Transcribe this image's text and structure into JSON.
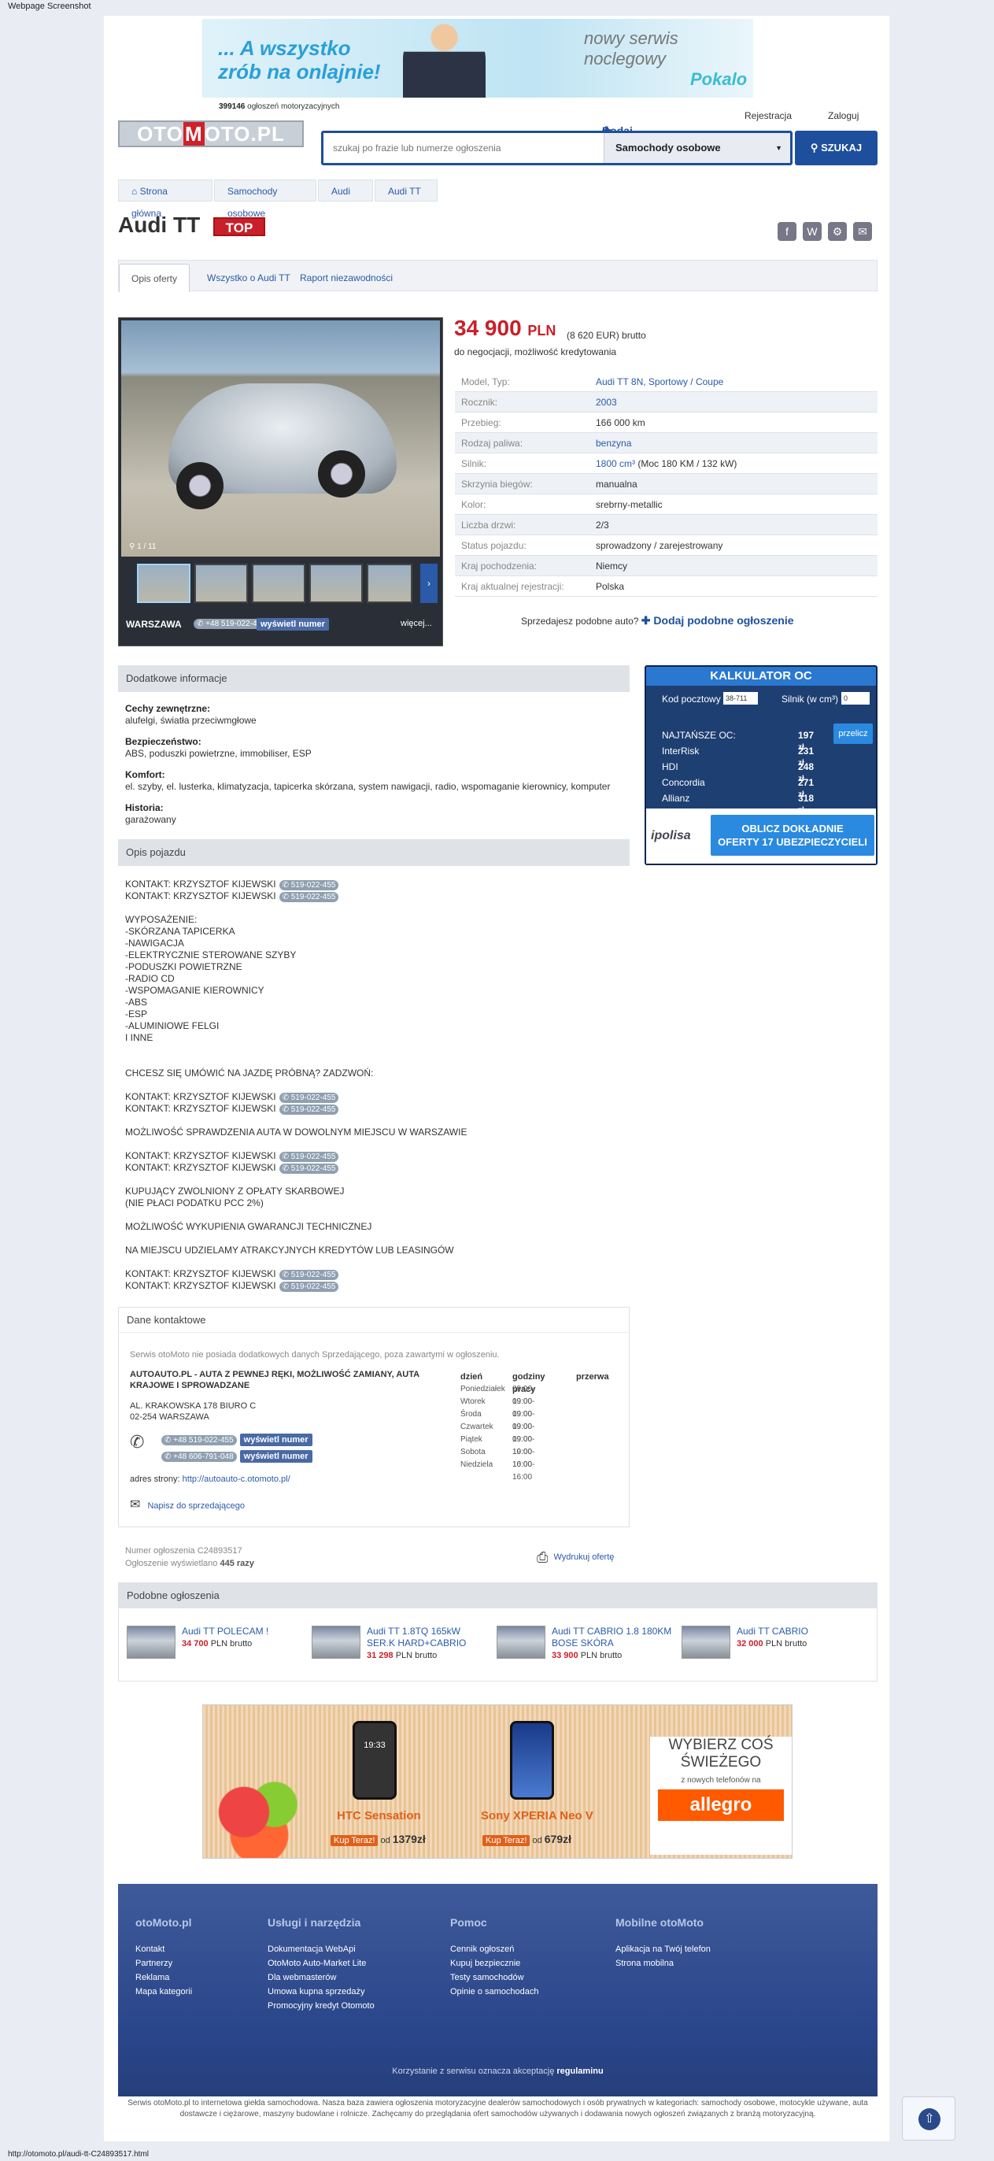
{
  "caption": "Webpage Screenshot",
  "banner_top": {
    "line1": "... A wszystko",
    "line2": "zrób na onlajnie!",
    "right1": "nowy serwis",
    "right2": "noclegowy",
    "logo": "Pokalo"
  },
  "header": {
    "count_num": "399146",
    "count_text": "ogłoszeń motoryzacyjnych",
    "add_ad": "Dodaj ogłoszenie",
    "register": "Rejestracja",
    "login": "Zaloguj",
    "logo_a": "OTO",
    "logo_m": "M",
    "logo_b": "OTO",
    "logo_pl": ".PL",
    "search_placeholder": "szukaj po frazie lub numerze ogłoszenia",
    "category": "Samochody osobowe",
    "search_btn": "SZUKAJ"
  },
  "breadcrumb": [
    "Strona główna",
    "Samochody osobowe",
    "Audi",
    "Audi TT"
  ],
  "title": "Audi TT",
  "badge": "TOP",
  "tabs": [
    "Opis oferty",
    "Wszystko o Audi TT",
    "Raport niezawodności"
  ],
  "photo": {
    "counter": "1 / 11",
    "location": "WARSZAWA",
    "phone": "+48 519-022-455",
    "show": "wyświetl numer",
    "more": "więcej..."
  },
  "price": {
    "value": "34 900",
    "currency": "PLN",
    "eur": "(8 620 EUR) brutto",
    "note": "do negocjacji, możliwość kredytowania"
  },
  "params": [
    {
      "k": "Model, Typ:",
      "v": "Audi TT 8N, Sportowy / Coupe"
    },
    {
      "k": "Rocznik:",
      "v": "2003"
    },
    {
      "k": "Przebieg:",
      "v": "166 000 km"
    },
    {
      "k": "Rodzaj paliwa:",
      "v": "benzyna"
    },
    {
      "k": "Silnik:",
      "v": "1800 cm³",
      "v2": "(Moc 180 KM / 132 kW)"
    },
    {
      "k": "Skrzynia biegów:",
      "v": "manualna"
    },
    {
      "k": "Kolor:",
      "v": "srebrny-metallic"
    },
    {
      "k": "Liczba drzwi:",
      "v": "2/3"
    },
    {
      "k": "Status pojazdu:",
      "v": "sprowadzony / zarejestrowany"
    },
    {
      "k": "Kraj pochodzenia:",
      "v": "Niemcy"
    },
    {
      "k": "Kraj aktualnej rejestracji:",
      "v": "Polska"
    }
  ],
  "similar_q": {
    "q": "Sprzedajesz podobne auto?",
    "link": "Dodaj podobne ogłoszenie"
  },
  "extra": {
    "header": "Dodatkowe informacje",
    "h1": "Cechy zewnętrzne:",
    "t1": "alufelgi, światła przeciwmgłowe",
    "h2": "Bezpieczeństwo:",
    "t2": "ABS, poduszki powietrzne, immobiliser, ESP",
    "h3": "Komfort:",
    "t3": "el. szyby, el. lusterka, klimatyzacja, tapicerka skórzana, system nawigacji, radio, wspomaganie kierownicy, komputer",
    "h4": "Historia:",
    "t4": "garażowany"
  },
  "calc": {
    "title": "KALKULATOR OC",
    "zip_label": "Kod pocztowy",
    "zip": "38-711",
    "engine_label": "Silnik (w cm³)",
    "engine": "0",
    "btn": "przelicz",
    "rows": [
      {
        "name": "NAJTAŃSZE OC:",
        "v": "197",
        "u": "zł"
      },
      {
        "name": "InterRisk",
        "v": "231",
        "u": "zł"
      },
      {
        "name": "HDI",
        "v": "248",
        "u": "zł"
      },
      {
        "name": "Concordia",
        "v": "271",
        "u": "zł"
      },
      {
        "name": "Allianz",
        "v": "318",
        "u": "zł"
      }
    ],
    "brand": "ipolisa",
    "cta1": "OBLICZ DOKŁADNIE",
    "cta2": "OFERTY 17 UBEZPIECZYCIELI"
  },
  "desc_header": "Opis pojazdu",
  "contact_line": "KONTAKT: KRZYSZTOF KIJEWSKI",
  "contact_phone": "519-022-455",
  "desc_lines": {
    "b1": "WYPOSAŻENIE:\n-SKÓRZANA TAPICERKA\n-NAWIGACJA\n-ELEKTRYCZNIE STEROWANE SZYBY\n-PODUSZKI POWIETRZNE\n-RADIO CD\n-WSPOMAGANIE KIEROWNICY\n-ABS\n-ESP\n-ALUMINIOWE FELGI\nI INNE",
    "b2": "CHCESZ SIĘ UMÓWIĆ NA JAZDĘ PRÓBNĄ? ZADZWOŃ:",
    "b3": "MOŻLIWOŚĆ SPRAWDZENIA AUTA W DOWOLNYM MIEJSCU W WARSZAWIE",
    "b4": "KUPUJĄCY ZWOLNIONY Z OPŁATY SKARBOWEJ\n(NIE PŁACI PODATKU PCC 2%)\n\nMOŻLIWOŚĆ WYKUPIENIA GWARANCJI TECHNICZNEJ\n\nNA MIEJSCU UDZIELAMY ATRAKCYJNYCH KREDYTÓW LUB LEASINGÓW"
  },
  "contact": {
    "header": "Dane kontaktowe",
    "note": "Serwis otoMoto nie posiada dodatkowych danych Sprzedającego, poza zawartymi w ogłoszeniu.",
    "name1": "AUTOAUTO.PL - AUTA Z PEWNEJ RĘKI, MOŻLIWOŚĆ ZAMIANY, AUTA",
    "name2": "KRAJOWE I SPROWADZANE",
    "addr1": "AL. KRAKOWSKA 178 BIURO C",
    "addr2": "02-254 WARSZAWA",
    "phone1": "+48 519-022-455",
    "phone2": "+48 606-791-048",
    "show": "wyświetl numer",
    "www_label": "adres strony:",
    "www": "http://autoauto-c.otomoto.pl/",
    "write": "Napisz do sprzedającego",
    "hours_h": [
      "dzień",
      "godziny pracy",
      "przerwa"
    ],
    "hours": [
      {
        "d": "Poniedziałek",
        "h": "09:00-19:00"
      },
      {
        "d": "Wtorek",
        "h": "09:00-19:00"
      },
      {
        "d": "Środa",
        "h": "09:00-19:00"
      },
      {
        "d": "Czwartek",
        "h": "09:00-19:00"
      },
      {
        "d": "Piątek",
        "h": "09:00-19:00"
      },
      {
        "d": "Sobota",
        "h": "10:00-16:00"
      },
      {
        "d": "Niedziela",
        "h": "10:00-16:00"
      }
    ]
  },
  "meta": {
    "num": "Numer ogłoszenia C24893517",
    "views_label": "Ogłoszenie wyświetlano",
    "views": "445 razy",
    "print": "Wydrukuj ofertę"
  },
  "similar": {
    "header": "Podobne ogłoszenia",
    "items": [
      {
        "t1": "Audi TT POLECAM !",
        "t2": "",
        "price": "34 700",
        "suffix": "PLN brutto"
      },
      {
        "t1": "Audi TT 1.8TQ 165kW",
        "t2": "SER.K HARD+CABRIO",
        "price": "31 298",
        "suffix": "PLN brutto"
      },
      {
        "t1": "Audi TT CABRIO 1.8 180KM",
        "t2": "BOSE SKÓRA",
        "price": "33 900",
        "suffix": "PLN brutto"
      },
      {
        "t1": "Audi TT CABRIO",
        "t2": "",
        "price": "32 000",
        "suffix": "PLN brutto"
      }
    ]
  },
  "ad2": {
    "p1": "HTC Sensation",
    "p2": "Sony XPERIA Neo V",
    "buy": "Kup Teraz!",
    "from": "od",
    "price1": "1379zł",
    "price2": "679zł",
    "right1": "WYBIERZ COŚ",
    "right2": "ŚWIEŻEGO",
    "right3": "z nowych telefonów na",
    "brand": "allegro",
    "clock": "19:33"
  },
  "footer": {
    "cols": [
      {
        "h": "otoMoto.pl",
        "items": [
          "Kontakt",
          "Partnerzy",
          "Reklama",
          "Mapa kategorii"
        ]
      },
      {
        "h": "Usługi i narzędzia",
        "items": [
          "Dokumentacja WebApi",
          "OtoMoto Auto-Market Lite",
          "Dla webmasterów",
          "Umowa kupna sprzedaży",
          "Promocyjny kredyt Otomoto"
        ]
      },
      {
        "h": "Pomoc",
        "items": [
          "Cennik ogłoszeń",
          "Kupuj bezpiecznie",
          "Testy samochodów",
          "Opinie o samochodach"
        ]
      },
      {
        "h": "Mobilne otoMoto",
        "items": [
          "Aplikacja na Twój telefon",
          "Strona mobilna"
        ]
      }
    ],
    "terms_pre": "Korzystanie z serwisu oznacza akceptację",
    "terms_link": "regulaminu",
    "note": "Serwis otoMoto.pl to internetowa giełda samochodowa. Nasza baza zawiera ogłoszenia motoryzacyjne dealerów samochodowych i osób prywatnych w kategoriach: samochody osobowe, motocykle używane, auta dostawcze i ciężarowe, maszyny budowlane i rolnicze. Zachęcamy do przeglądania ofert samochodów używanych i dodawania nowych ogłoszeń związanych z branżą motoryzacyjną."
  },
  "status_url": "http://otomoto.pl/audi-tt-C24893517.html",
  "colors": {
    "brand_blue": "#1d4f9c",
    "price_red": "#c8202a",
    "link": "#2a5aa8"
  }
}
